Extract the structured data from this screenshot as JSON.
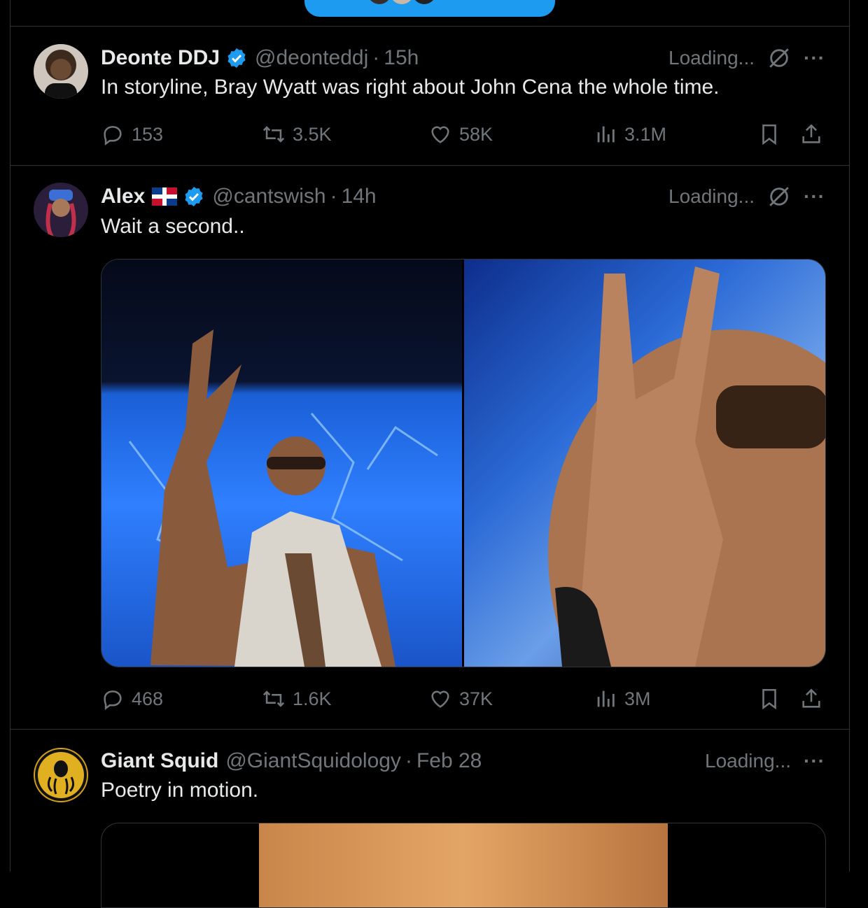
{
  "tweets": [
    {
      "name": "Deonte DDJ",
      "handle": "@deonteddj",
      "time": "15h",
      "status": "Loading...",
      "text": "In storyline, Bray Wyatt was right about John Cena the whole time.",
      "replies": "153",
      "retweets": "3.5K",
      "likes": "58K",
      "views": "3.1M"
    },
    {
      "name": "Alex",
      "handle": "@cantswish",
      "time": "14h",
      "status": "Loading...",
      "text": "Wait a second..",
      "replies": "468",
      "retweets": "1.6K",
      "likes": "37K",
      "views": "3M"
    },
    {
      "name": "Giant Squid",
      "handle": "@GiantSquidology",
      "time": "Feb 28",
      "status": "Loading...",
      "text": "Poetry in motion."
    }
  ],
  "separator": "·",
  "more_label": "···",
  "icons": [
    "verified-badge-icon",
    "grok-slash-icon",
    "reply-icon",
    "retweet-icon",
    "like-icon",
    "views-icon",
    "bookmark-icon",
    "share-icon",
    "more-icon"
  ],
  "colors": {
    "background": "#000000",
    "accent": "#1d9bf0",
    "muted": "#71767b",
    "border": "#2f3336"
  }
}
